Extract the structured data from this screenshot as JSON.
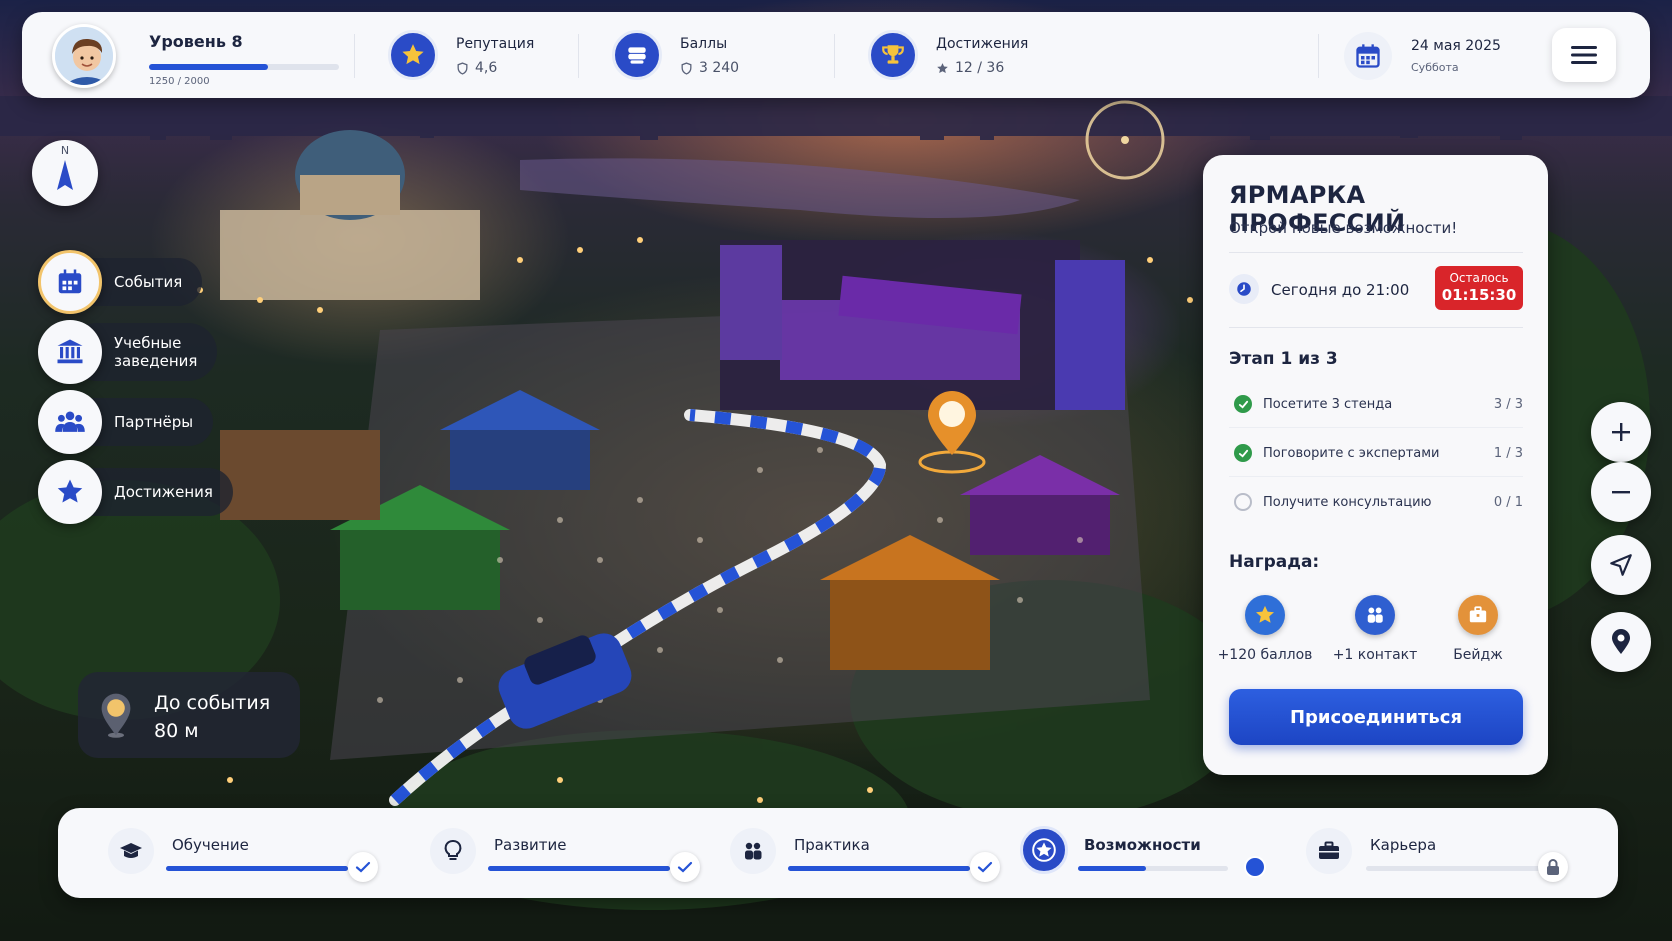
{
  "player": {
    "level_label": "Уровень 8",
    "xp_text": "1250 / 2000",
    "xp_fraction": 0.625
  },
  "stats": [
    {
      "label": "Репутация",
      "value": "4,6",
      "icon": "star-icon"
    },
    {
      "label": "Баллы",
      "value": "3 240",
      "icon": "coins-icon"
    },
    {
      "label": "Достижения",
      "value": "12 / 36",
      "icon": "trophy-icon"
    }
  ],
  "date": {
    "main": "24 мая 2025",
    "sub": "Суббота"
  },
  "compass": {
    "north": "N"
  },
  "left_nav": [
    {
      "label": "События",
      "icon": "calendar-icon",
      "active": true
    },
    {
      "label": "Учебные\nзаведения",
      "icon": "university-icon",
      "active": false
    },
    {
      "label": "Партнёры",
      "icon": "people-icon",
      "active": false
    },
    {
      "label": "Достижения",
      "icon": "star-icon",
      "active": false
    }
  ],
  "distance": {
    "label": "До события",
    "value": "80 м"
  },
  "event": {
    "title": "ЯРМАРКА ПРОФЕССИЙ",
    "subtitle": "Открой новые возможности!",
    "time_text": "Сегодня до 21:00",
    "timer_label": "Осталось",
    "timer_value": "01:15:30",
    "stage_title": "Этап 1 из 3",
    "tasks": [
      {
        "label": "Посетите 3 стенда",
        "count": "3 / 3",
        "done": true
      },
      {
        "label": "Поговорите с экспертами",
        "count": "1 / 3",
        "done": true
      },
      {
        "label": "Получите консультацию",
        "count": "0 / 1",
        "done": false
      }
    ],
    "reward_title": "Награда:",
    "rewards": [
      {
        "label": "+120 баллов",
        "icon": "star-icon",
        "color": "#2f6fd8"
      },
      {
        "label": "+1 контакт",
        "icon": "people-icon",
        "color": "#2f5fd0"
      },
      {
        "label": "Бейдж",
        "icon": "briefcase-icon",
        "color": "#e3923a"
      }
    ],
    "join_label": "Присоединиться"
  },
  "map_controls": [
    "plus-icon",
    "minus-icon",
    "navigate-icon",
    "location-pin-icon"
  ],
  "steps": [
    {
      "label": "Обучение",
      "icon": "graduation-cap-icon",
      "progress": 1.0,
      "state": "done"
    },
    {
      "label": "Развитие",
      "icon": "lightbulb-icon",
      "progress": 1.0,
      "state": "done"
    },
    {
      "label": "Практика",
      "icon": "people-icon",
      "progress": 1.0,
      "state": "done"
    },
    {
      "label": "Возможности",
      "icon": "star-icon",
      "progress": 0.45,
      "state": "active"
    },
    {
      "label": "Карьера",
      "icon": "briefcase-icon",
      "progress": 0.0,
      "state": "locked"
    }
  ],
  "colors": {
    "accent": "#2553d6",
    "timer_red": "#d9252a",
    "done_green": "#2f9a4a",
    "gold": "#f2c46b"
  }
}
